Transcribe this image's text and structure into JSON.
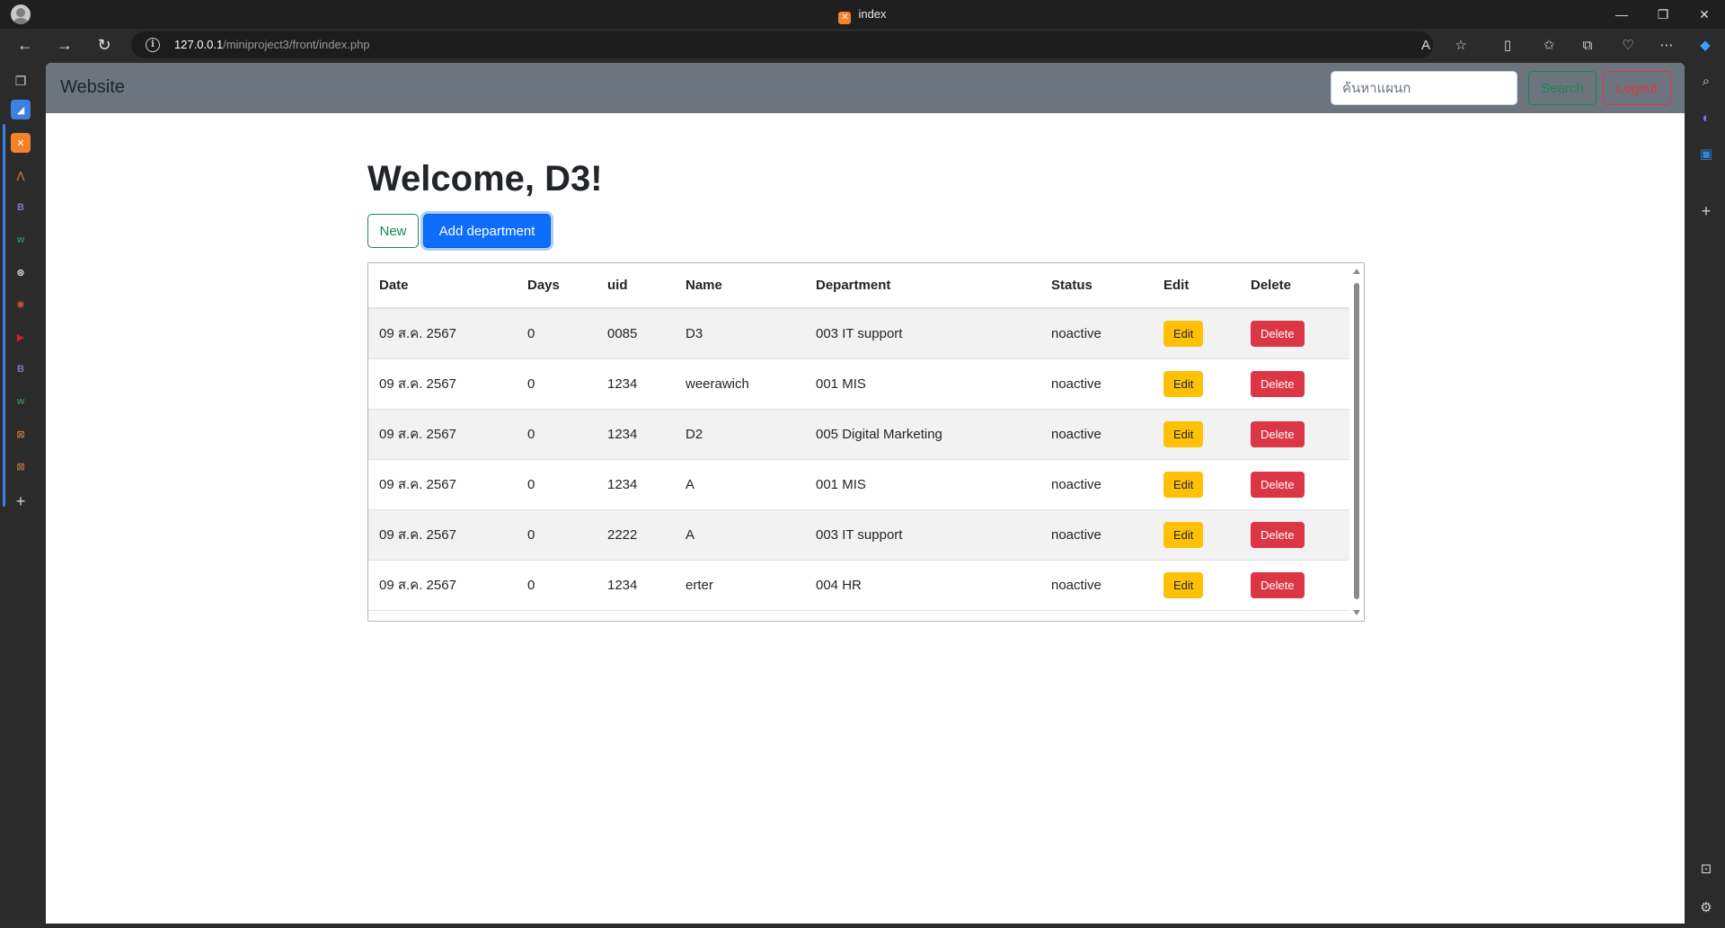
{
  "browser": {
    "tab_title": "index",
    "url_host": "127.0.0.1",
    "url_path": "/miniproject3/front/index.php"
  },
  "navbar": {
    "brand": "Website",
    "search_placeholder": "ค้นหาแผนก",
    "search_label": "Search",
    "logout_label": "Logout"
  },
  "main": {
    "welcome": "Welcome, D3!",
    "new_label": "New",
    "add_department_label": "Add department"
  },
  "table": {
    "headers": [
      "Date",
      "Days",
      "uid",
      "Name",
      "Department",
      "Status",
      "Edit",
      "Delete"
    ],
    "edit_label": "Edit",
    "delete_label": "Delete",
    "rows": [
      {
        "date": "09 ส.ค. 2567",
        "days": "0",
        "uid": "0085",
        "name": "D3",
        "department": "003 IT support",
        "status": "noactive"
      },
      {
        "date": "09 ส.ค. 2567",
        "days": "0",
        "uid": "1234",
        "name": "weerawich",
        "department": "001 MIS",
        "status": "noactive"
      },
      {
        "date": "09 ส.ค. 2567",
        "days": "0",
        "uid": "1234",
        "name": "D2",
        "department": "005 Digital Marketing",
        "status": "noactive"
      },
      {
        "date": "09 ส.ค. 2567",
        "days": "0",
        "uid": "1234",
        "name": "A",
        "department": "001 MIS",
        "status": "noactive"
      },
      {
        "date": "09 ส.ค. 2567",
        "days": "0",
        "uid": "2222",
        "name": "A",
        "department": "003 IT support",
        "status": "noactive"
      },
      {
        "date": "09 ส.ค. 2567",
        "days": "0",
        "uid": "1234",
        "name": "erter",
        "department": "004 HR",
        "status": "noactive"
      }
    ]
  },
  "colors": {
    "navbar_bg": "#6c757d",
    "success": "#198754",
    "danger": "#dc3545",
    "primary": "#0d6efd",
    "warning": "#ffc107"
  }
}
